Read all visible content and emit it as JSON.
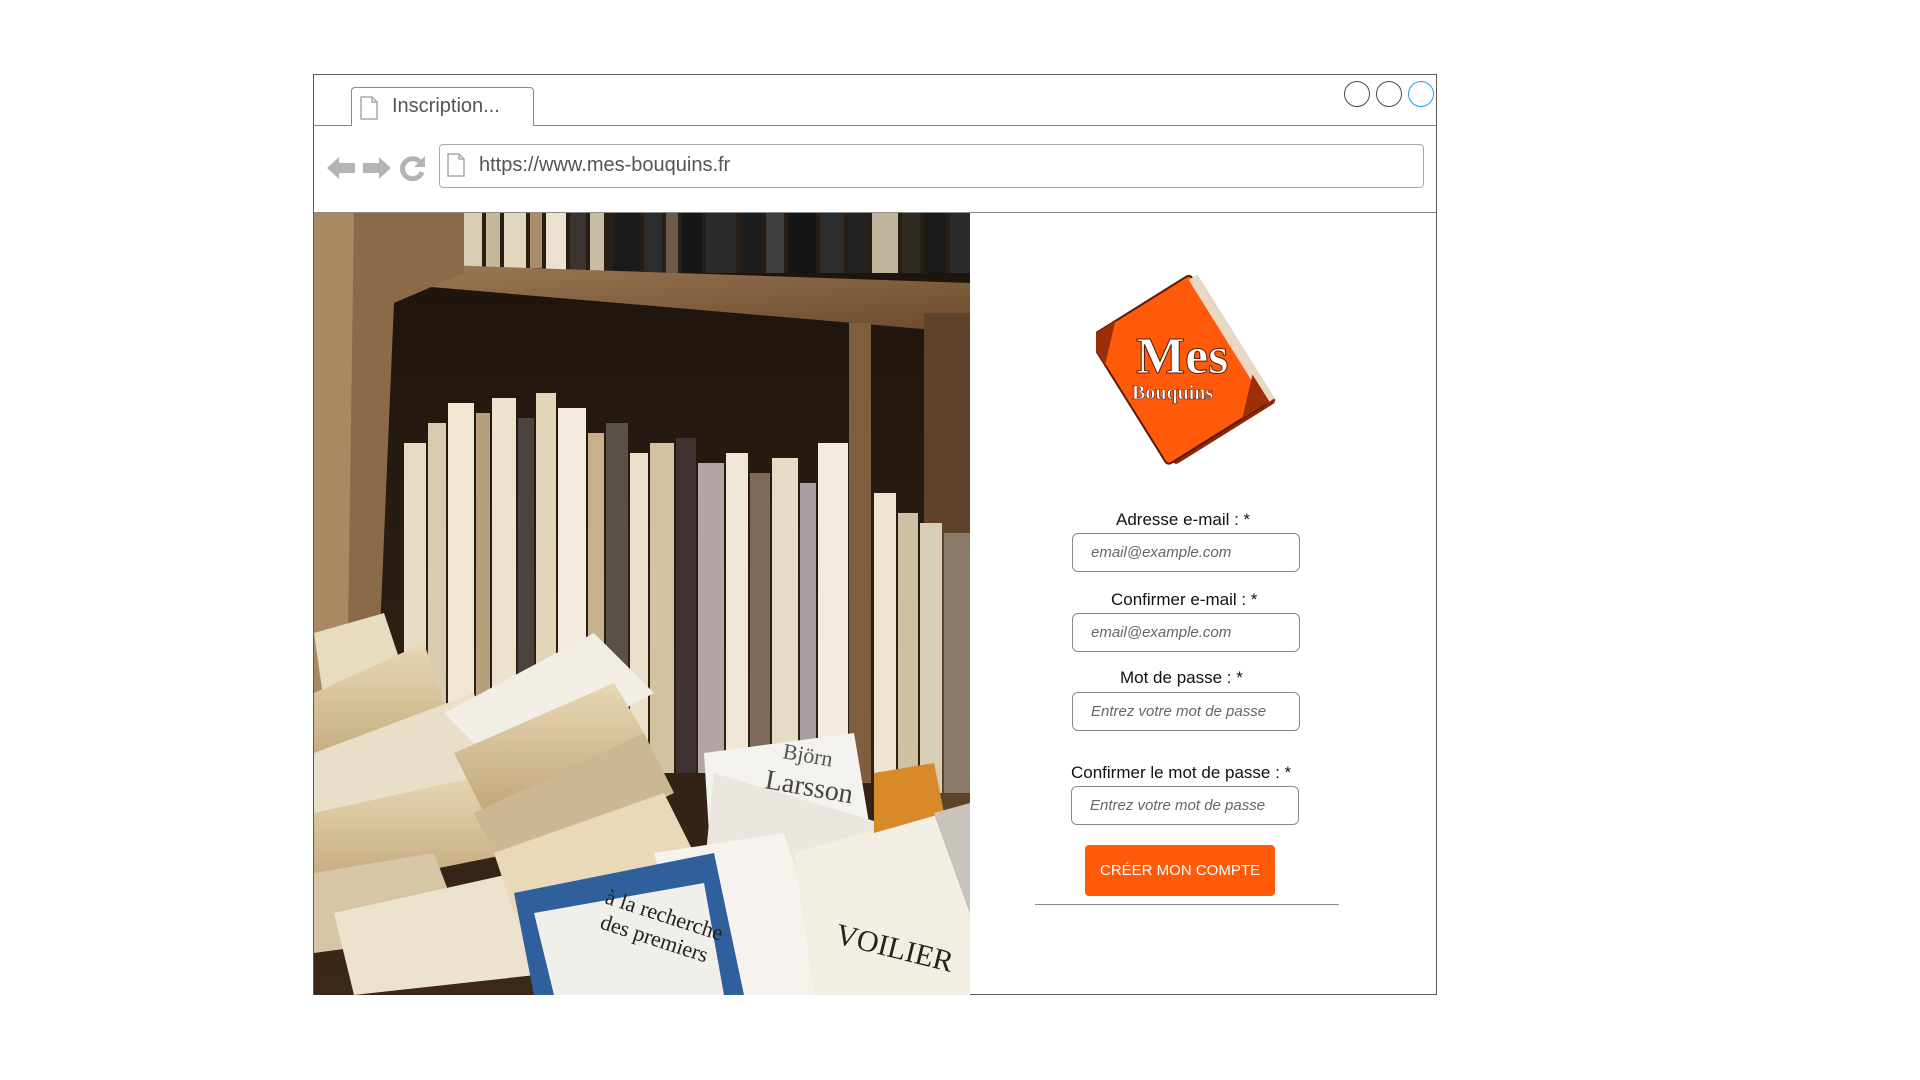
{
  "browser": {
    "tab_title": "Inscription...",
    "url": "https://www.mes-bouquins.fr"
  },
  "logo": {
    "line1": "Mes",
    "line2": "Bouquins",
    "color": "#ff5a0a"
  },
  "form": {
    "email_label": "Adresse e-mail : *",
    "email_placeholder": "email@example.com",
    "confirm_email_label": "Confirmer e-mail : *",
    "confirm_email_placeholder": "email@example.com",
    "password_label": "Mot de passe : *",
    "password_placeholder": "Entrez votre mot de passe",
    "confirm_password_label": "Confirmer le mot de passe : *",
    "confirm_password_placeholder": "Entrez votre mot de passe",
    "submit_label": "CRÉER MON COMPTE"
  },
  "photo_text": {
    "book1_author": "Björn",
    "book1_title": "Larsson",
    "book2_title1": "à la recherche",
    "book2_title2": "des premiers",
    "book3_title": "VOILIER"
  },
  "icons": {
    "back": "arrow-left-icon",
    "forward": "arrow-right-icon",
    "reload": "reload-icon",
    "page": "document-icon"
  },
  "colors": {
    "accent": "#ff5a0a",
    "window_button_active": "#2a9be8"
  }
}
